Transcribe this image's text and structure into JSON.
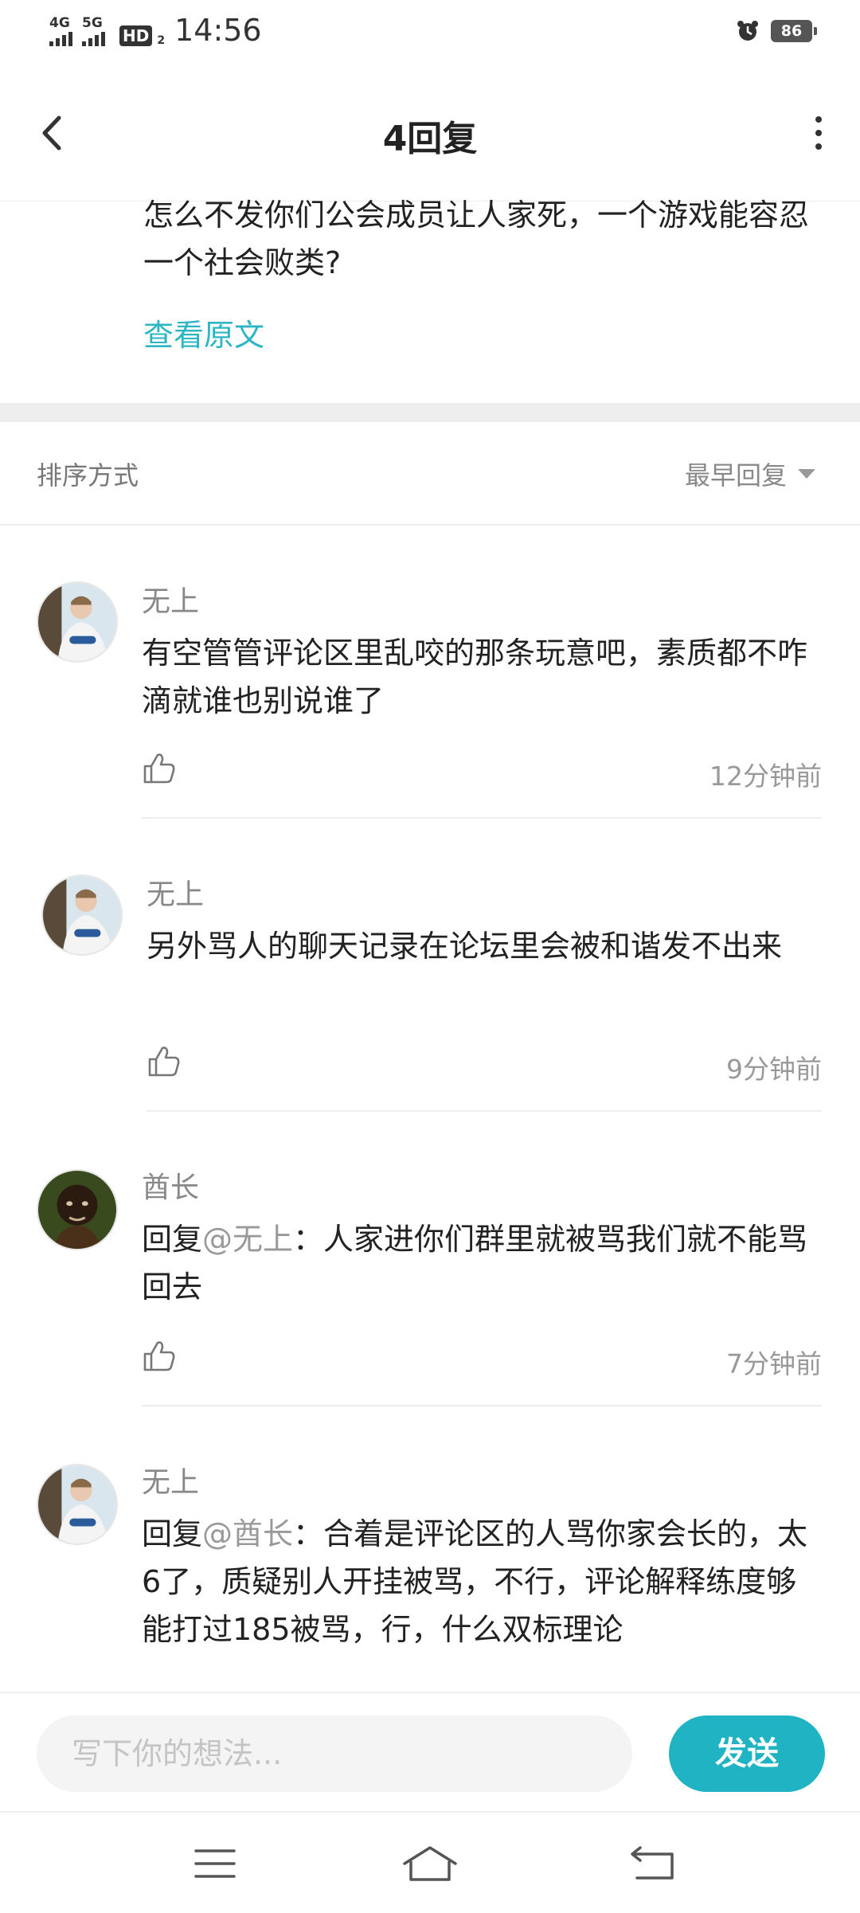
{
  "status_bar": {
    "network1": "4G",
    "network2": "5G",
    "hd": "HD",
    "hd_sub": "2",
    "time": "14:56",
    "battery": "86"
  },
  "header": {
    "title": "4回复"
  },
  "original_post": {
    "text": "怎么不发你们公会成员让人家死，一个游戏能容忍一个社会败类?",
    "view_original": "查看原文"
  },
  "sort": {
    "label": "排序方式",
    "value": "最早回复"
  },
  "comments": [
    {
      "author": "无上",
      "prefix": "",
      "mention": "",
      "text": "有空管管评论区里乱咬的那条玩意吧，素质都不咋滴就谁也别说谁了",
      "time": "12分钟前",
      "avatar": "person-photo"
    },
    {
      "author": "无上",
      "prefix": "",
      "mention": "",
      "text": "另外骂人的聊天记录在论坛里会被和谐发不出来",
      "time": "9分钟前",
      "avatar": "person-photo"
    },
    {
      "author": "酋长",
      "prefix": "回复",
      "mention": "@无上",
      "text": "：人家进你们群里就被骂我们就不能骂回去",
      "time": "7分钟前",
      "avatar": "dark-portrait"
    },
    {
      "author": "无上",
      "prefix": "回复",
      "mention": "@酋长",
      "text": "：合着是评论区的人骂你家会长的，太6了，质疑别人开挂被骂，不行，评论解释练度够能打过185被骂，行，什么双标理论",
      "time": "",
      "avatar": "person-photo"
    }
  ],
  "input": {
    "placeholder": "写下你的想法..."
  },
  "send_label": "发送",
  "colors": {
    "accent": "#1fb3c3",
    "link": "#2cb6c4"
  }
}
